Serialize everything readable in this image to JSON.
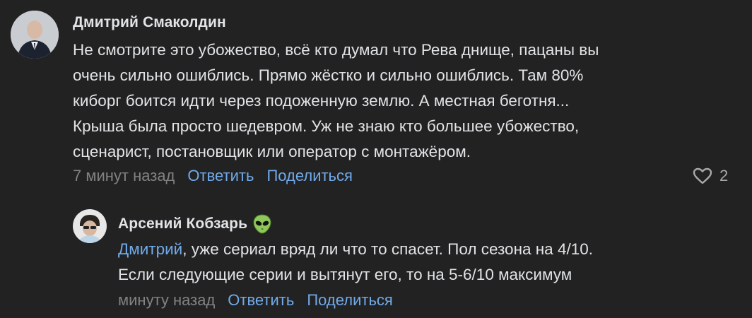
{
  "comment": {
    "author": "Дмитрий Смаколдин",
    "lines": [
      "Не смотрите это убожество, всё кто думал что Рева днище, пацаны вы",
      "очень сильно ошиблись. Прямо жёстко и сильно ошиблись. Там 80%",
      "киборг боится идти через подоженную землю. А местная беготня...",
      "Крыша была просто шедевром. Уж не знаю кто большее убожество,",
      "сценарист, постановщик или оператор с монтажёром."
    ],
    "time": "7 минут назад",
    "reply_label": "Ответить",
    "share_label": "Поделиться",
    "likes": "2",
    "like_icon": "heart-outline-icon"
  },
  "reply": {
    "author": "Арсений Кобзарь",
    "author_badge": "alien-emoji",
    "mention": "Дмитрий",
    "line1_rest": ", уже сериал вряд ли что то спасет. Пол сезона на 4/10.",
    "line2": "Если следующие серии и вытянут его, то на 5-6/10 максимум",
    "time": "минуту назад",
    "reply_label": "Ответить",
    "share_label": "Поделиться"
  },
  "colors": {
    "background": "#222222",
    "text": "#e1e3e6",
    "link": "#71aaeb",
    "muted": "#828282"
  }
}
